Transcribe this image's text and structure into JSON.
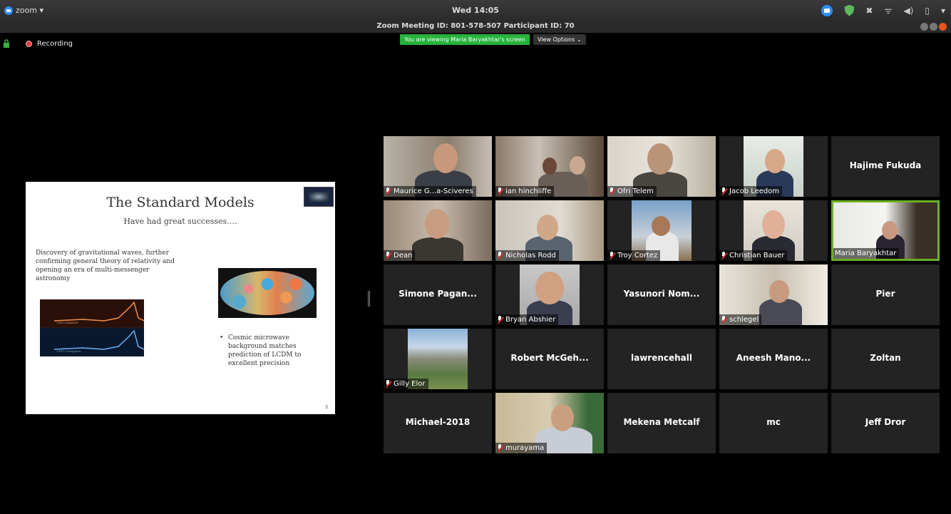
{
  "system_bar": {
    "app_menu": "zoom ▾",
    "clock": "Wed 14:05",
    "tray_icons": [
      "zoom-tray-icon",
      "shield-icon",
      "dropbox-icon",
      "wifi-icon",
      "volume-icon",
      "battery-icon",
      "menu-chevron-icon"
    ],
    "tray_glyphs": {
      "dropbox": "✖",
      "wifi": "ᯤ",
      "volume": "◀)",
      "battery": "▯",
      "chevron": "▾"
    }
  },
  "window": {
    "title": "Zoom Meeting ID: 801-578-507 Participant ID: 70",
    "buttons": [
      "minimize",
      "maximize",
      "close"
    ]
  },
  "recording": {
    "label": "Recording"
  },
  "share_banner": {
    "viewing_text": "You are viewing Maria Baryakhtar's screen",
    "view_options": "View Options ⌄"
  },
  "slide": {
    "title": "The Standard Models",
    "subtitle": "Have had great successes….",
    "left_text": "Discovery of gravitational waves, further confirming general theory of relativity and opening an era of multi-messenger astronomy",
    "bullet_mark": "•",
    "right_bullet": "Cosmic microwave background matches prediction of LCDM to excellent precision",
    "gw_labels": [
      "LIGO Hanford",
      "LIGO Livingston"
    ],
    "page_number": "3"
  },
  "gallery": {
    "colors": {
      "tile_bg": "#232323",
      "active_border": "#6ab023",
      "banner_green": "#26b33b"
    },
    "tiles": [
      {
        "name": "Maurice G...a-Sciveres",
        "video": true,
        "muted": true
      },
      {
        "name": "ian hinchliffe",
        "video": true,
        "muted": true
      },
      {
        "name": "Ofri Telem",
        "video": true,
        "muted": true
      },
      {
        "name": "Jacob Leedom",
        "video": true,
        "muted": true
      },
      {
        "name": "Hajime Fukuda",
        "video": false,
        "muted": false
      },
      {
        "name": "Dean",
        "video": true,
        "muted": true
      },
      {
        "name": "Nicholas Rodd",
        "video": true,
        "muted": true
      },
      {
        "name": "Troy Cortez",
        "video": true,
        "muted": true
      },
      {
        "name": "Christian Bauer",
        "video": true,
        "muted": true
      },
      {
        "name": "Maria Baryakhtar",
        "video": true,
        "muted": false,
        "active": true
      },
      {
        "name": "Simone Pagan...",
        "video": false,
        "muted": false
      },
      {
        "name": "Bryan Abshier",
        "video": true,
        "muted": true
      },
      {
        "name": "Yasunori Nom...",
        "video": false,
        "muted": false
      },
      {
        "name": "schlegel",
        "video": true,
        "muted": true
      },
      {
        "name": "Pier",
        "video": false,
        "muted": false
      },
      {
        "name": "Gilly Elor",
        "video": true,
        "muted": true
      },
      {
        "name": "Robert McGeh...",
        "video": false,
        "muted": false
      },
      {
        "name": "lawrencehall",
        "video": false,
        "muted": false
      },
      {
        "name": "Aneesh Mano...",
        "video": false,
        "muted": false
      },
      {
        "name": "Zoltan",
        "video": false,
        "muted": false
      },
      {
        "name": "Michael-2018",
        "video": false,
        "muted": false
      },
      {
        "name": "murayama",
        "video": true,
        "muted": true
      },
      {
        "name": "Mekena Metcalf",
        "video": false,
        "muted": false
      },
      {
        "name": "mc",
        "video": false,
        "muted": false
      },
      {
        "name": "Jeff Dror",
        "video": false,
        "muted": false
      }
    ]
  }
}
